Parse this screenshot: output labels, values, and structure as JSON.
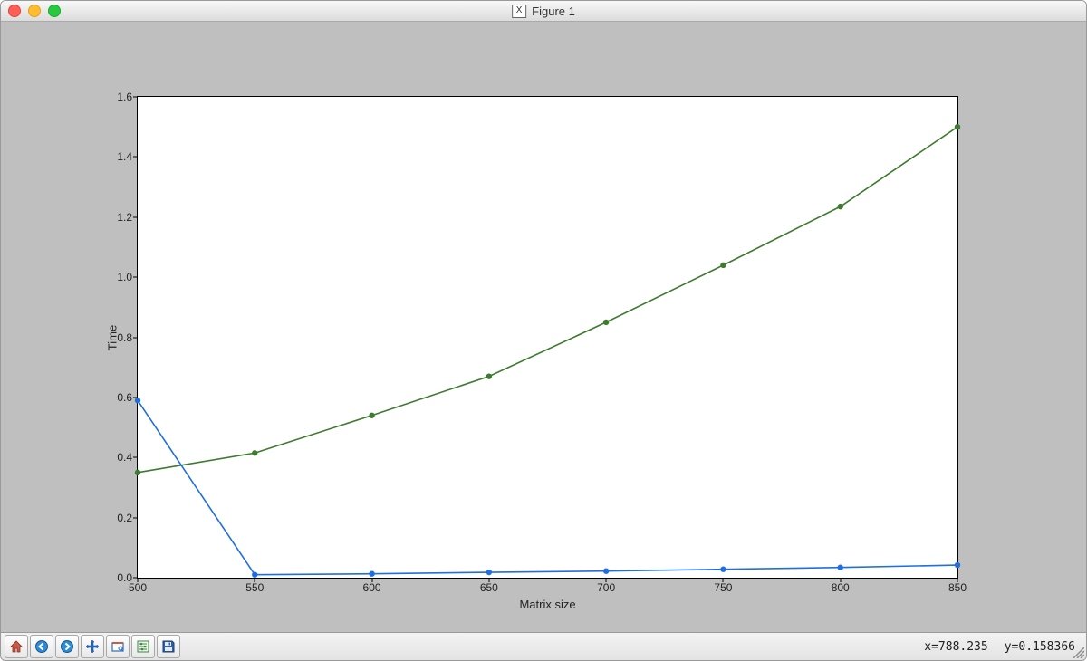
{
  "window": {
    "title": "Figure 1",
    "platform": "macOS"
  },
  "toolbar": {
    "home": "Home",
    "back": "Back",
    "forward": "Forward",
    "pan": "Pan",
    "zoom": "Zoom",
    "subplots": "Configure subplots",
    "save": "Save"
  },
  "status": {
    "x_label": "x=788.235",
    "y_label": "y=0.158366"
  },
  "chart_data": {
    "type": "line",
    "xlabel": "Matrix size",
    "ylabel": "Time",
    "title": "",
    "xlim": [
      500,
      850
    ],
    "ylim": [
      0.0,
      1.6
    ],
    "xticks": [
      500,
      550,
      600,
      650,
      700,
      750,
      800,
      850
    ],
    "yticks": [
      0.0,
      0.2,
      0.4,
      0.6,
      0.8,
      1.0,
      1.2,
      1.4,
      1.6
    ],
    "series": [
      {
        "name": "series-green",
        "color": "#3e7a2f",
        "marker": "circle",
        "x": [
          500,
          550,
          600,
          650,
          700,
          750,
          800,
          850
        ],
        "y": [
          0.35,
          0.415,
          0.54,
          0.67,
          0.85,
          1.04,
          1.235,
          1.5
        ]
      },
      {
        "name": "series-blue",
        "color": "#1f6fe0",
        "marker": "circle",
        "x": [
          500,
          550,
          600,
          650,
          700,
          750,
          800,
          850
        ],
        "y": [
          0.59,
          0.01,
          0.013,
          0.018,
          0.022,
          0.028,
          0.034,
          0.042
        ]
      }
    ]
  }
}
